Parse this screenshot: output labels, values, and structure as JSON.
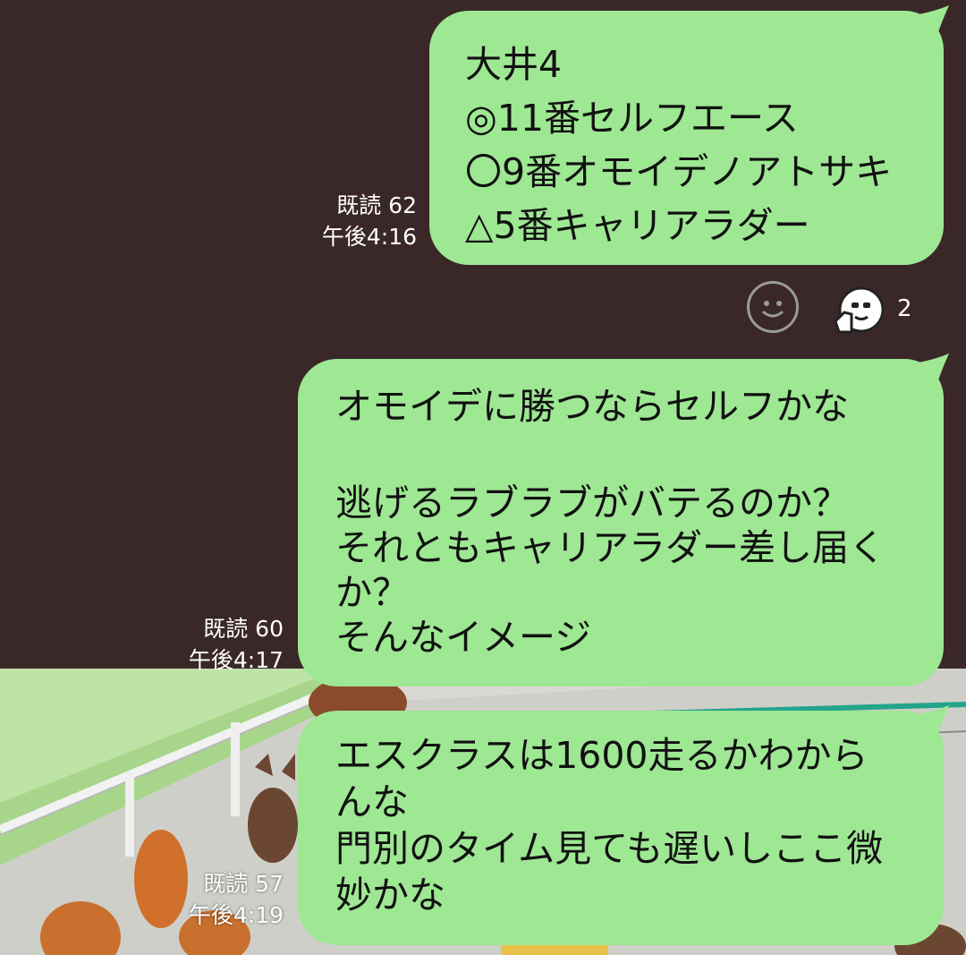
{
  "messages": [
    {
      "lines": [
        "大井4",
        "◎11番セルフエース",
        "〇9番オモイデノアトサキ",
        "△5番キャリアラダー"
      ],
      "read": "既読 62",
      "time": "午後4:16"
    },
    {
      "lines": [
        "オモイデに勝つならセルフかな",
        "",
        "逃げるラブラブがバテるのか？",
        "それともキャリアラダー差し届く",
        "か？",
        "そんなイメージ"
      ],
      "read": "既読 60",
      "time": "午後4:17"
    },
    {
      "lines": [
        "エスクラスは1600走るかわから",
        "んな",
        "門別のタイム見ても遅いしここ微",
        "妙かな"
      ],
      "read": "既読 57",
      "time": "午後4:19"
    }
  ],
  "reactions": {
    "add_icon": "smiley-add-icon",
    "sticker_icon": "thumbs-up-face-icon",
    "count": "2"
  },
  "colors": {
    "background": "#3a2829",
    "bubble": "#9ee793",
    "meta_text": "#ffffff"
  }
}
